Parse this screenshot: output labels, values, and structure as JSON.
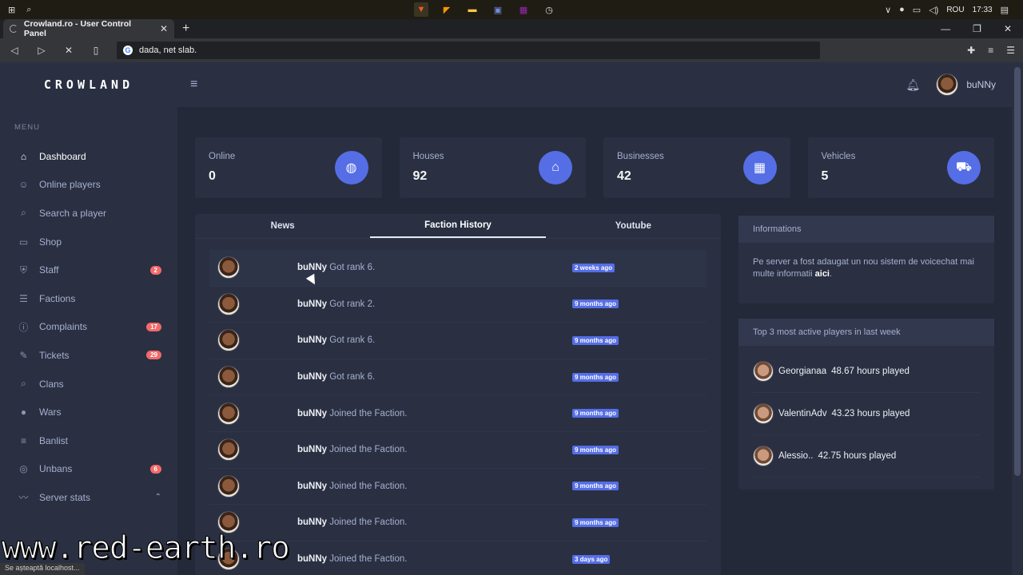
{
  "taskbar": {
    "start_icon": "windows-logo",
    "search_icon": "search-icon",
    "apps": [
      "brave-icon",
      "sublime-icon",
      "explorer-icon",
      "discord-icon",
      "winrar-icon",
      "clock-icon"
    ],
    "language": "ROU",
    "time": "17:33"
  },
  "browser": {
    "tab_title": "Crowland.ro - User Control Panel",
    "address": "dada, net slab.",
    "status_text": "Se așteaptă localhost..."
  },
  "sidebar": {
    "logo": "CROWLAND",
    "menu_title": "MENU",
    "items": [
      {
        "label": "Dashboard",
        "icon": "home-icon",
        "glyph": "⌂",
        "badge": ""
      },
      {
        "label": "Online players",
        "icon": "user-icon",
        "glyph": "☺",
        "badge": ""
      },
      {
        "label": "Search a player",
        "icon": "search-icon",
        "glyph": "⌕",
        "badge": ""
      },
      {
        "label": "Shop",
        "icon": "store-icon",
        "glyph": "▭",
        "badge": ""
      },
      {
        "label": "Staff",
        "icon": "shield-icon",
        "glyph": "⛨",
        "badge": "2"
      },
      {
        "label": "Factions",
        "icon": "group-icon",
        "glyph": "☰",
        "badge": ""
      },
      {
        "label": "Complaints",
        "icon": "info-icon",
        "glyph": "ⓘ",
        "badge": "17"
      },
      {
        "label": "Tickets",
        "icon": "ticket-icon",
        "glyph": "✎",
        "badge": "29"
      },
      {
        "label": "Clans",
        "icon": "search-icon",
        "glyph": "⌕",
        "badge": ""
      },
      {
        "label": "Wars",
        "icon": "bomb-icon",
        "glyph": "●",
        "badge": ""
      },
      {
        "label": "Banlist",
        "icon": "list-icon",
        "glyph": "≡",
        "badge": ""
      },
      {
        "label": "Unbans",
        "icon": "check-circle-icon",
        "glyph": "◎",
        "badge": "6"
      },
      {
        "label": "Server stats",
        "icon": "chart-icon",
        "glyph": "〰",
        "badge": ""
      }
    ]
  },
  "header": {
    "username": "buNNy"
  },
  "stats": [
    {
      "label": "Online",
      "value": "0",
      "icon": "globe-icon",
      "glyph": "◍"
    },
    {
      "label": "Houses",
      "value": "92",
      "icon": "home-icon",
      "glyph": "⌂"
    },
    {
      "label": "Businesses",
      "value": "42",
      "icon": "building-icon",
      "glyph": "▦"
    },
    {
      "label": "Vehicles",
      "value": "5",
      "icon": "car-icon",
      "glyph": "⛟"
    }
  ],
  "tabs": [
    "News",
    "Faction History",
    "Youtube"
  ],
  "history": [
    {
      "user": "buNNy",
      "action": "Got rank 6.",
      "time": "2 weeks ago"
    },
    {
      "user": "buNNy",
      "action": "Got rank 2.",
      "time": "9 months ago"
    },
    {
      "user": "buNNy",
      "action": "Got rank 6.",
      "time": "9 months ago"
    },
    {
      "user": "buNNy",
      "action": "Got rank 6.",
      "time": "9 months ago"
    },
    {
      "user": "buNNy",
      "action": "Joined the Faction.",
      "time": "9 months ago"
    },
    {
      "user": "buNNy",
      "action": "Joined the Faction.",
      "time": "9 months ago"
    },
    {
      "user": "buNNy",
      "action": "Joined the Faction.",
      "time": "9 months ago"
    },
    {
      "user": "buNNy",
      "action": "Joined the Faction.",
      "time": "9 months ago"
    },
    {
      "user": "buNNy",
      "action": "Joined the Faction.",
      "time": "3 days ago"
    }
  ],
  "informations": {
    "title": "Informations",
    "text": "Pe server a fost adaugat un nou sistem de voicechat mai multe informatii",
    "link": "aici",
    "suffix": "."
  },
  "top_players": {
    "title": "Top 3 most active players in last week",
    "players": [
      {
        "name": "Georgianaa",
        "hours": "48.67 hours played"
      },
      {
        "name": "ValentinAdv",
        "hours": "43.23 hours played"
      },
      {
        "name": "Alessio..",
        "hours": "42.75 hours played"
      }
    ]
  },
  "watermark": "www.red-earth.ro",
  "colors": {
    "accent": "#556ee6",
    "sidebar_bg": "#2a3042",
    "page_bg": "#242939",
    "badge": "#f46a6a"
  }
}
